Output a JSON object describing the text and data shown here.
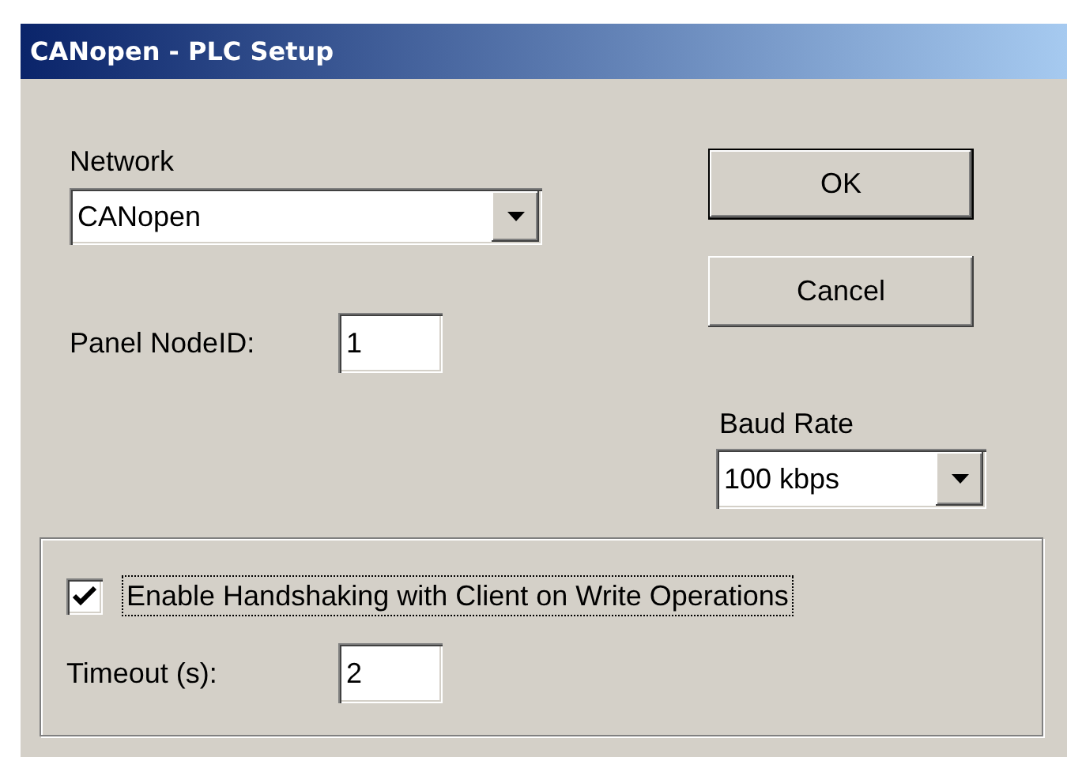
{
  "window": {
    "title": "CANopen - PLC Setup"
  },
  "network": {
    "label": "Network",
    "value": "CANopen"
  },
  "panel_node_id": {
    "label": "Panel NodeID:",
    "value": "1"
  },
  "buttons": [
    {
      "label": "OK",
      "default": true
    },
    {
      "label": "Cancel",
      "default": false
    }
  ],
  "baud_rate": {
    "label": "Baud Rate",
    "value": "100 kbps"
  },
  "handshaking": {
    "label": "Enable Handshaking with Client on Write Operations",
    "checked": true,
    "focused": true
  },
  "timeout": {
    "label": "Timeout (s):",
    "value": "2"
  }
}
